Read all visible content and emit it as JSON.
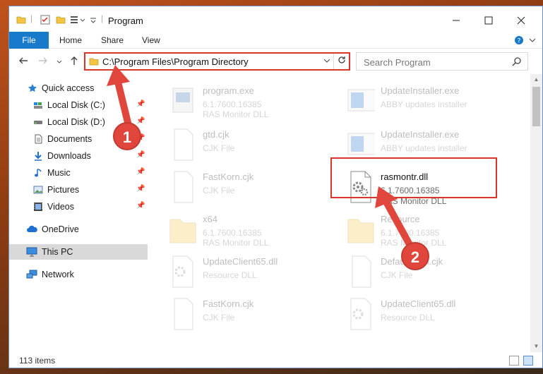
{
  "window": {
    "title": "Program"
  },
  "ribbon": {
    "tabs": [
      "File",
      "Home",
      "Share",
      "View"
    ]
  },
  "address": {
    "path": "C:\\Program Files\\Program Directory"
  },
  "search": {
    "placeholder": "Search Program"
  },
  "nav": {
    "items": [
      {
        "label": "Quick access",
        "icon": "star-icon"
      },
      {
        "label": "Local Disk (C:)",
        "icon": "drive-icon",
        "pinned": true
      },
      {
        "label": "Local Disk (D:)",
        "icon": "drive-icon",
        "pinned": true
      },
      {
        "label": "Documents",
        "icon": "document-icon",
        "pinned": true
      },
      {
        "label": "Downloads",
        "icon": "download-icon",
        "pinned": true
      },
      {
        "label": "Music",
        "icon": "music-icon",
        "pinned": true
      },
      {
        "label": "Pictures",
        "icon": "pictures-icon",
        "pinned": true
      },
      {
        "label": "Videos",
        "icon": "videos-icon",
        "pinned": true
      },
      {
        "label": "OneDrive",
        "icon": "cloud-icon"
      },
      {
        "label": "This PC",
        "icon": "computer-icon",
        "selected": true
      },
      {
        "label": "Network",
        "icon": "network-icon"
      }
    ]
  },
  "files": [
    {
      "name": "program.exe",
      "line1": "6.1.7600.16385",
      "line2": "RAS Monitor DLL",
      "icon": "exe-icon",
      "faded": true
    },
    {
      "name": "UpdateInstaller.exe",
      "line1": "ABBY updates installer",
      "line2": "",
      "icon": "installer-icon",
      "faded": true
    },
    {
      "name": "gtd.cjk",
      "line1": "CJK File",
      "line2": "",
      "icon": "file-icon",
      "faded": true
    },
    {
      "name": "UpdateInstaller.exe",
      "line1": "ABBY updates installer",
      "line2": "",
      "icon": "installer-icon",
      "faded": true
    },
    {
      "name": "FastKorn.cjk",
      "line1": "CJK File",
      "line2": "",
      "icon": "file-icon",
      "faded": true
    },
    {
      "name": "rasmontr.dll",
      "line1": "6.1.7600.16385",
      "line2": "RAS Monitor DLL",
      "icon": "dll-gear-icon",
      "faded": false
    },
    {
      "name": "x64",
      "line1": "6.1.7600.16385",
      "line2": "RAS Monitor DLL",
      "icon": "folder-icon",
      "faded": true
    },
    {
      "name": "Resource",
      "line1": "6.1.7600.16385",
      "line2": "RAS Monitor DLL",
      "icon": "folder-icon",
      "faded": true
    },
    {
      "name": "UpdateClient65.dll",
      "line1": "Resource DLL",
      "line2": "",
      "icon": "dll-gear-icon",
      "faded": true
    },
    {
      "name": "DefaultKorn.cjk",
      "line1": "CJK File",
      "line2": "",
      "icon": "file-icon",
      "faded": true
    },
    {
      "name": "FastKorn.cjk",
      "line1": "CJK File",
      "line2": "",
      "icon": "file-icon",
      "faded": true
    },
    {
      "name": "UpdateClient65.dll",
      "line1": "Resource DLL",
      "line2": "",
      "icon": "dll-gear-icon",
      "faded": true
    }
  ],
  "status": {
    "text": "113 items"
  },
  "callouts": [
    "1",
    "2"
  ],
  "colors": {
    "highlight": "#d9352a",
    "file_tab": "#1979ca",
    "badge": "#e0463c"
  }
}
